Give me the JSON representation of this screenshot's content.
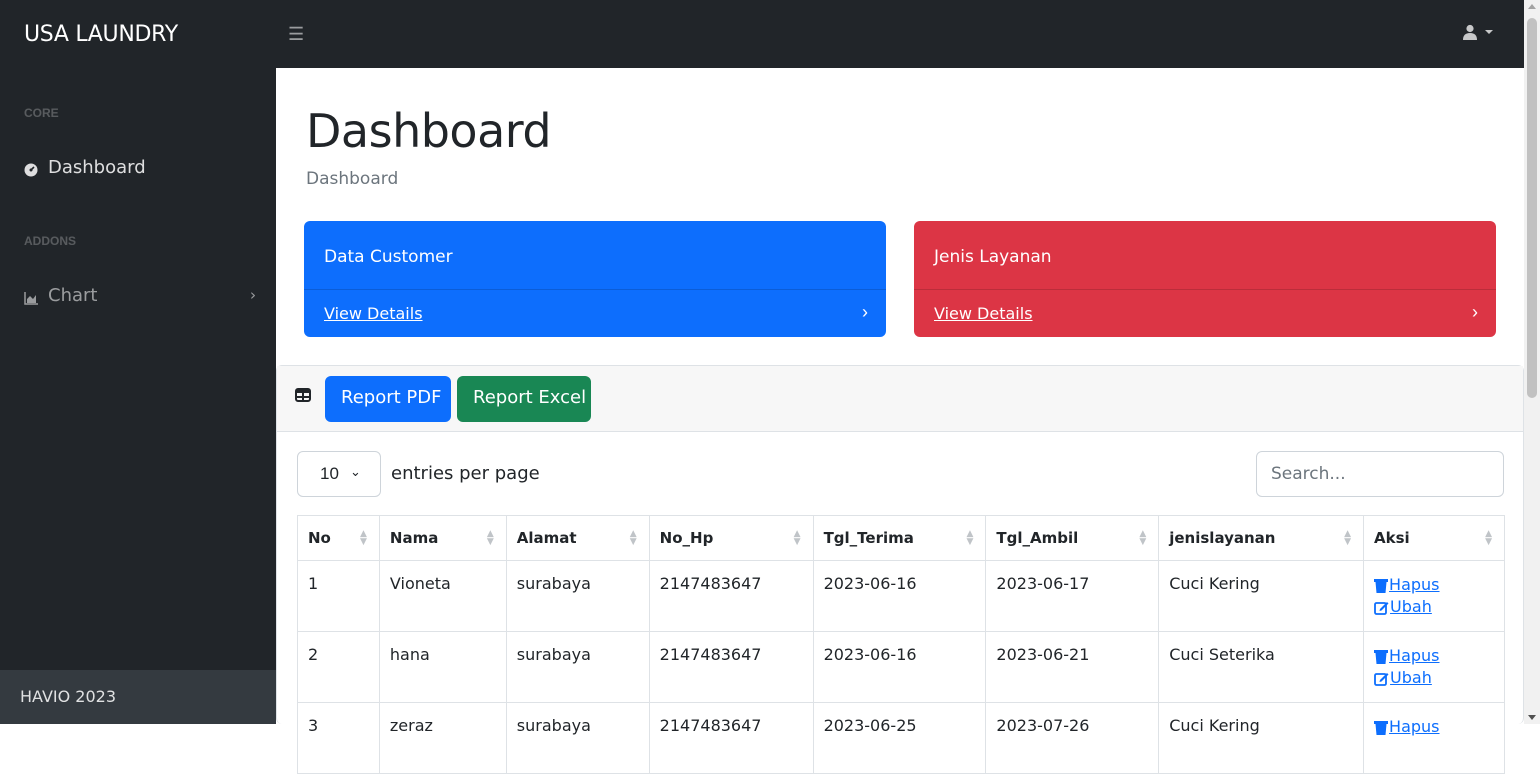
{
  "navbar": {
    "brand": "USA LAUNDRY",
    "toggle_icon": "hamburger-icon",
    "user_icon": "user-icon"
  },
  "sidebar": {
    "headings": [
      "CORE",
      "ADDONS"
    ],
    "items": [
      {
        "label": "Dashboard",
        "icon": "tachometer-icon"
      },
      {
        "label": "Chart",
        "icon": "area-chart-icon"
      }
    ],
    "footer": "HAVIO 2023"
  },
  "main": {
    "title": "Dashboard",
    "breadcrumb": "Dashboard",
    "cards": [
      {
        "title": "Data Customer",
        "link": "View Details",
        "color": "#0d6efd"
      },
      {
        "title": "Jenis Layanan",
        "link": "View Details",
        "color": "#dc3545"
      }
    ]
  },
  "table_card": {
    "report_pdf": "Report PDF",
    "report_excel": "Report Excel",
    "per_page_value": "10",
    "per_page_label": "entries per page",
    "search_placeholder": "Search...",
    "columns": [
      "No",
      "Nama",
      "Alamat",
      "No_Hp",
      "Tgl_Terima",
      "Tgl_Ambil",
      "jenislayanan",
      "Aksi"
    ],
    "rows": [
      {
        "no": "1",
        "nama": "Vioneta",
        "alamat": "surabaya",
        "hp": "2147483647",
        "terima": "2023-06-16",
        "ambil": "2023-06-17",
        "layanan": "Cuci Kering"
      },
      {
        "no": "2",
        "nama": "hana",
        "alamat": "surabaya",
        "hp": "2147483647",
        "terima": "2023-06-16",
        "ambil": "2023-06-21",
        "layanan": "Cuci Seterika"
      },
      {
        "no": "3",
        "nama": "zeraz",
        "alamat": "surabaya",
        "hp": "2147483647",
        "terima": "2023-06-25",
        "ambil": "2023-07-26",
        "layanan": "Cuci Kering"
      }
    ],
    "action_delete": "Hapus",
    "action_edit": "Ubah"
  },
  "colors": {
    "dark": "#212529",
    "primary": "#0d6efd",
    "danger": "#dc3545",
    "success": "#198754"
  }
}
